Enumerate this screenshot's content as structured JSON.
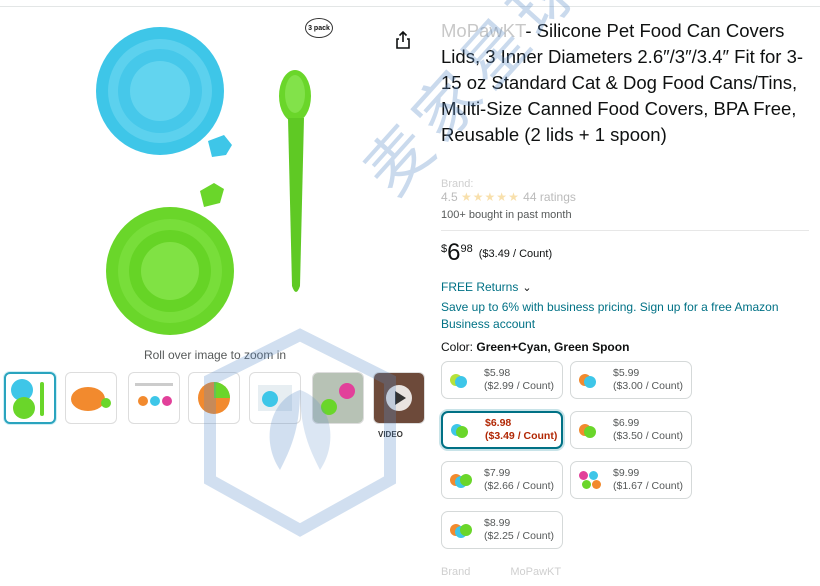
{
  "product": {
    "brand": "MoPawKT",
    "title_rest": "- Silicone Pet Food Can Covers Lids, 3 Inner Diameters 2.6″/3″/3.4″ Fit for 3-15 oz Standard Cat & Dog Food Cans/Tins, Multi-Size Canned Food Covers, BPA Free, Reusable (2 lids + 1 spoon)",
    "brand_line": "Brand:",
    "ratings_score": "4.5",
    "ratings_count": "44 ratings",
    "bought": "100+ bought in past month"
  },
  "price": {
    "symbol": "$",
    "whole": "6",
    "fraction": "98",
    "unit": "($3.49 / Count)"
  },
  "returns_label": "FREE Returns",
  "business_text": "Save up to 6% with business pricing. Sign up for a free Amazon Business account",
  "color": {
    "label": "Color:",
    "selected": "Green+Cyan, Green Spoon"
  },
  "options": [
    {
      "price": "$5.98",
      "unit": "($2.99 / Count)",
      "colors": [
        "#b6e23a",
        "#3ec6e8"
      ]
    },
    {
      "price": "$5.99",
      "unit": "($3.00 / Count)",
      "colors": [
        "#f28a2e",
        "#3ec6e8"
      ]
    },
    {
      "price": "$6.98",
      "unit": "($3.49 / Count)",
      "colors": [
        "#3ec6e8",
        "#6ad62a"
      ]
    },
    {
      "price": "$6.99",
      "unit": "($3.50 / Count)",
      "colors": [
        "#f28a2e",
        "#6ad62a"
      ]
    },
    {
      "price": "$7.99",
      "unit": "($2.66 / Count)",
      "colors": [
        "#f28a2e",
        "#3ec6e8",
        "#6ad62a"
      ]
    },
    {
      "price": "$9.99",
      "unit": "($1.67 / Count)",
      "colors": [
        "#e2409a",
        "#3ec6e8",
        "#6ad62a",
        "#f28a2e"
      ]
    },
    {
      "price": "$8.99",
      "unit": "($2.25 / Count)",
      "colors": [
        "#f28a2e",
        "#3ec6e8",
        "#6ad62a"
      ]
    }
  ],
  "selected_option": 2,
  "image": {
    "badge": "3 pack",
    "zoom_hint": "Roll over image to zoom in",
    "video_label": "VIDEO"
  },
  "bottom": {
    "label": "Brand",
    "value": "MoPawKT"
  },
  "watermark": "麦家星球",
  "colors": {
    "link": "#007185",
    "price_red": "#b12704",
    "cyan_lid": "#3ec6e8",
    "green_lid": "#6ad62a"
  }
}
